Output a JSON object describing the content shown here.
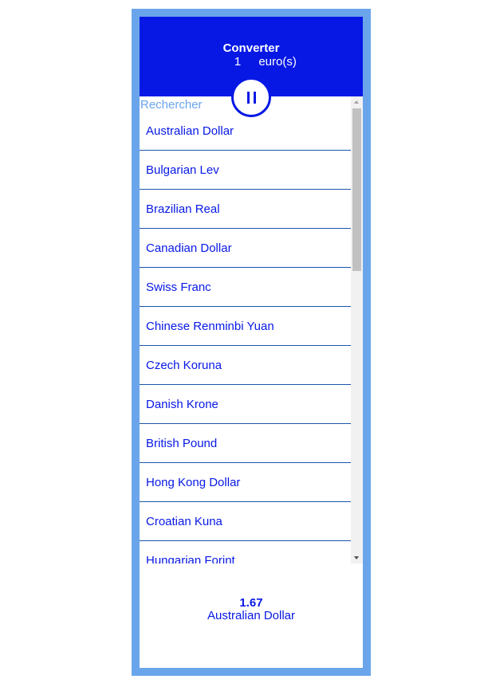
{
  "header": {
    "title": "Converter",
    "amount": "1",
    "unit": "euro(s)"
  },
  "search": {
    "placeholder": "Rechercher",
    "value": ""
  },
  "currencies": [
    "Australian Dollar",
    "Bulgarian Lev",
    "Brazilian Real",
    "Canadian Dollar",
    "Swiss Franc",
    "Chinese Renminbi Yuan",
    "Czech Koruna",
    "Danish Krone",
    "British Pound",
    "Hong Kong Dollar",
    "Croatian Kuna",
    "Hungarian Forint"
  ],
  "result": {
    "value": "1.67",
    "currency": "Australian Dollar"
  },
  "colors": {
    "primary": "#0718e5",
    "frame": "#6aa5eb",
    "divider": "#1b55a9"
  },
  "icons": {
    "center_button": "pause-icon"
  }
}
